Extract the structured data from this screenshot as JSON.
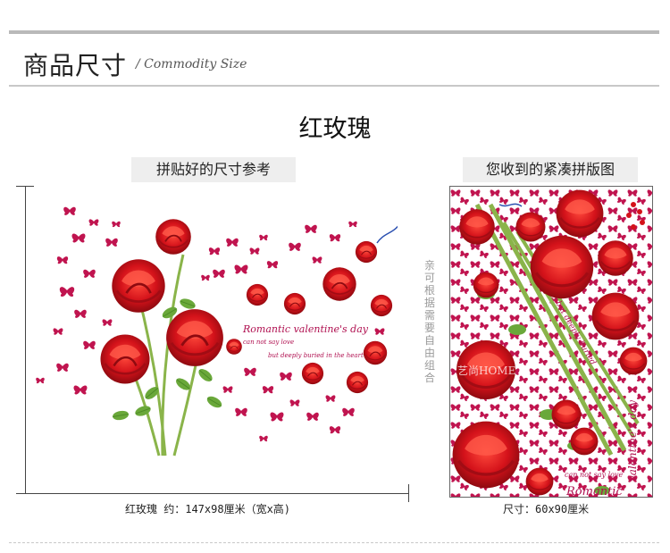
{
  "header": {
    "title": "商品尺寸",
    "subtitle": "/ Commodity Size"
  },
  "product": {
    "name": "红玫瑰"
  },
  "labels": {
    "applied_size_reference": "拼贴好的尺寸参考",
    "received_layout": "您收到的紧凑拼版图"
  },
  "left_image": {
    "text_line1": "Romantic valentine's day",
    "text_line2": "can not say love",
    "text_line3": "but deeply buried in the heart",
    "caption": "红玫瑰  约：147x98厘米（宽x高)"
  },
  "right_image": {
    "watermark": "艺尚HOME",
    "text_romantic": "Romantic",
    "text_valentine": "valentine's day",
    "text_can_not": "can not say love",
    "text_buried": "but deeply buried",
    "caption": "尺寸：60x90厘米"
  },
  "note_vertical": "亲可根据需要自由组合",
  "colors": {
    "rose_red": "#d4121a",
    "butterfly": "#c0144f",
    "stem_green": "#8ab44a",
    "text_magenta": "#b01050"
  }
}
